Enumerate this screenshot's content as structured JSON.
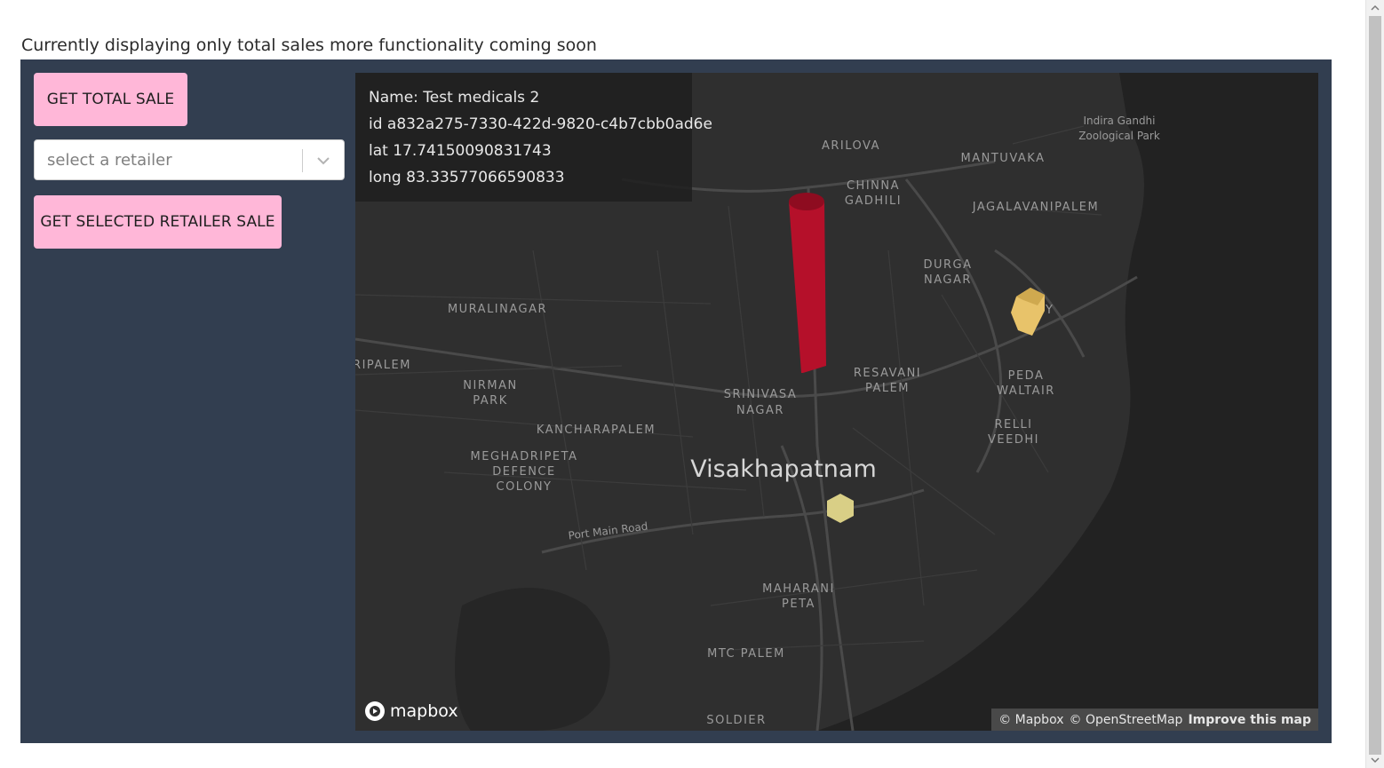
{
  "intro_text": "Currently displaying only total sales more functionality coming soon",
  "controls": {
    "total_sale_label": "GET TOTAL SALE",
    "retailer_select_placeholder": "select a retailer",
    "selected_retailer_sale_label": "GET SELECTED RETAILER SALE"
  },
  "tooltip": {
    "name": "Name: Test medicals 2",
    "id": "id a832a275-7330-422d-9820-c4b7cbb0ad6e",
    "lat": "lat 17.74150090831743",
    "long": "long 83.33577066590833"
  },
  "map": {
    "city": "Visakhapatnam",
    "places": {
      "indira_1": "Indira Gandhi",
      "indira_2": "Zoological Park",
      "arilova": "ARILOVA",
      "mantuvaka": "MANTUVAKA",
      "chinna": "CHINNA",
      "gadhili": "GADHILI",
      "jagalavanipalem": "JAGALAVANIPALEM",
      "durga": "DURGA",
      "nagar": "NAGAR",
      "muralinagar": "MURALINAGAR",
      "colony_partial": "C    NY",
      "ripalem": "RIPALEM",
      "resavani": "RESAVANI",
      "palem_resavani": "PALEM",
      "peda": "PEDA",
      "waltair": "WALTAIR",
      "nirman": "NIRMAN",
      "park": "PARK",
      "srinivasa": "SRINIVASA",
      "srinivasa_nagar": "NAGAR",
      "relli": "RELLI",
      "veedhi": "VEEDHI",
      "kancharapalem": "KANCHARAPALEM",
      "meghadripeta": "MEGHADRIPETA",
      "defence": "DEFENCE",
      "colony": "COLONY",
      "port_main_road": "Port Main Road",
      "maharani": "MAHARANI",
      "peta": "PETA",
      "mtc_palem": "MTC PALEM",
      "soldier": "SOLDIER"
    },
    "logo_text": "mapbox",
    "attribution": {
      "mapbox": "© Mapbox",
      "osm": "© OpenStreetMap",
      "improve": "Improve this map"
    },
    "colors": {
      "tall_bar": "#b5102a",
      "mid_hex": "#e8c36a",
      "low_hex": "#d9cf86",
      "water": "#222222",
      "land": "#2f2f2f"
    }
  }
}
